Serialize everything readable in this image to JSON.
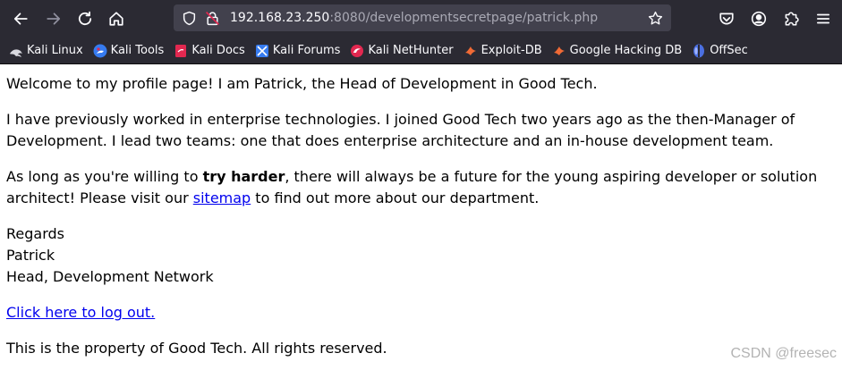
{
  "browser": {
    "url_host": "192.168.23.250",
    "url_rest": ":8080/developmentsecretpage/patrick.php"
  },
  "icons": {
    "back": "arrow-left-icon",
    "forward": "arrow-right-icon",
    "reload": "reload-icon",
    "home": "home-icon",
    "shield": "shield-icon",
    "insecure": "insecure-lock-icon",
    "bookmark_star": "star-icon",
    "pocket": "pocket-icon",
    "account": "account-icon",
    "extensions": "puzzle-icon",
    "menu": "hamburger-menu-icon"
  },
  "bookmarks": [
    {
      "label": "Kali Linux",
      "icon": "kali-dragon-icon"
    },
    {
      "label": "Kali Tools",
      "icon": "kali-tools-icon"
    },
    {
      "label": "Kali Docs",
      "icon": "kali-docs-icon"
    },
    {
      "label": "Kali Forums",
      "icon": "kali-forums-icon"
    },
    {
      "label": "Kali NetHunter",
      "icon": "nethunter-icon"
    },
    {
      "label": "Exploit-DB",
      "icon": "exploit-db-icon"
    },
    {
      "label": "Google Hacking DB",
      "icon": "ghdb-icon"
    },
    {
      "label": "OffSec",
      "icon": "offsec-icon"
    }
  ],
  "content": {
    "p1": "Welcome to my profile page! I am Patrick, the Head of Development in Good Tech.",
    "p2": "I have previously worked in enterprise technologies. I joined Good Tech two years ago as the then-Manager of Development. I lead two teams: one that does enterprise architecture and an in-house development team.",
    "p3_pre": "As long as you're willing to ",
    "p3_bold": "try harder",
    "p3_mid": ", there will always be a future for the young aspiring developer or solution architect! Please visit our ",
    "p3_link": "sitemap",
    "p3_post": " to find out more about our department.",
    "regards": "Regards",
    "name": "Patrick",
    "role": "Head, Development Network",
    "logout_link": "Click here to log out.",
    "footer": "This is the property of Good Tech. All rights reserved."
  },
  "watermark": "CSDN @freesec"
}
